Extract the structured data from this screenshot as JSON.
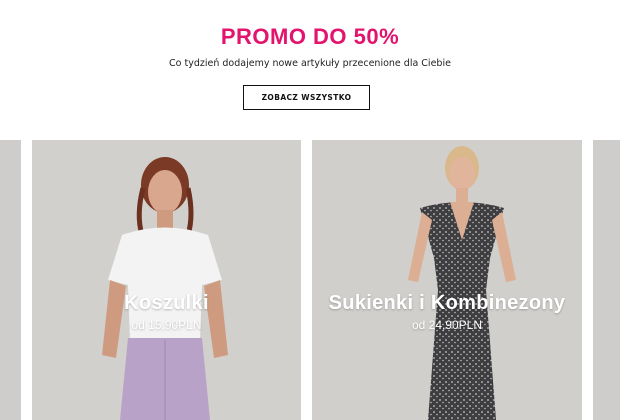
{
  "promo": {
    "title": "PROMO DO 50%",
    "subtitle": "Co tydzień dodajemy nowe artykuły przecenione dla Ciebie",
    "button_label": "ZOBACZ WSZYSTKO",
    "accent_color": "#e2146e"
  },
  "categories": [
    {
      "title": "Koszulki",
      "price": "od 15,90PLN",
      "image": "model-white-tshirt-lilac-jeans"
    },
    {
      "title": "Sukienki i Kombinezony",
      "price": "od 24,90PLN",
      "image": "model-patterned-jumpsuit"
    }
  ]
}
